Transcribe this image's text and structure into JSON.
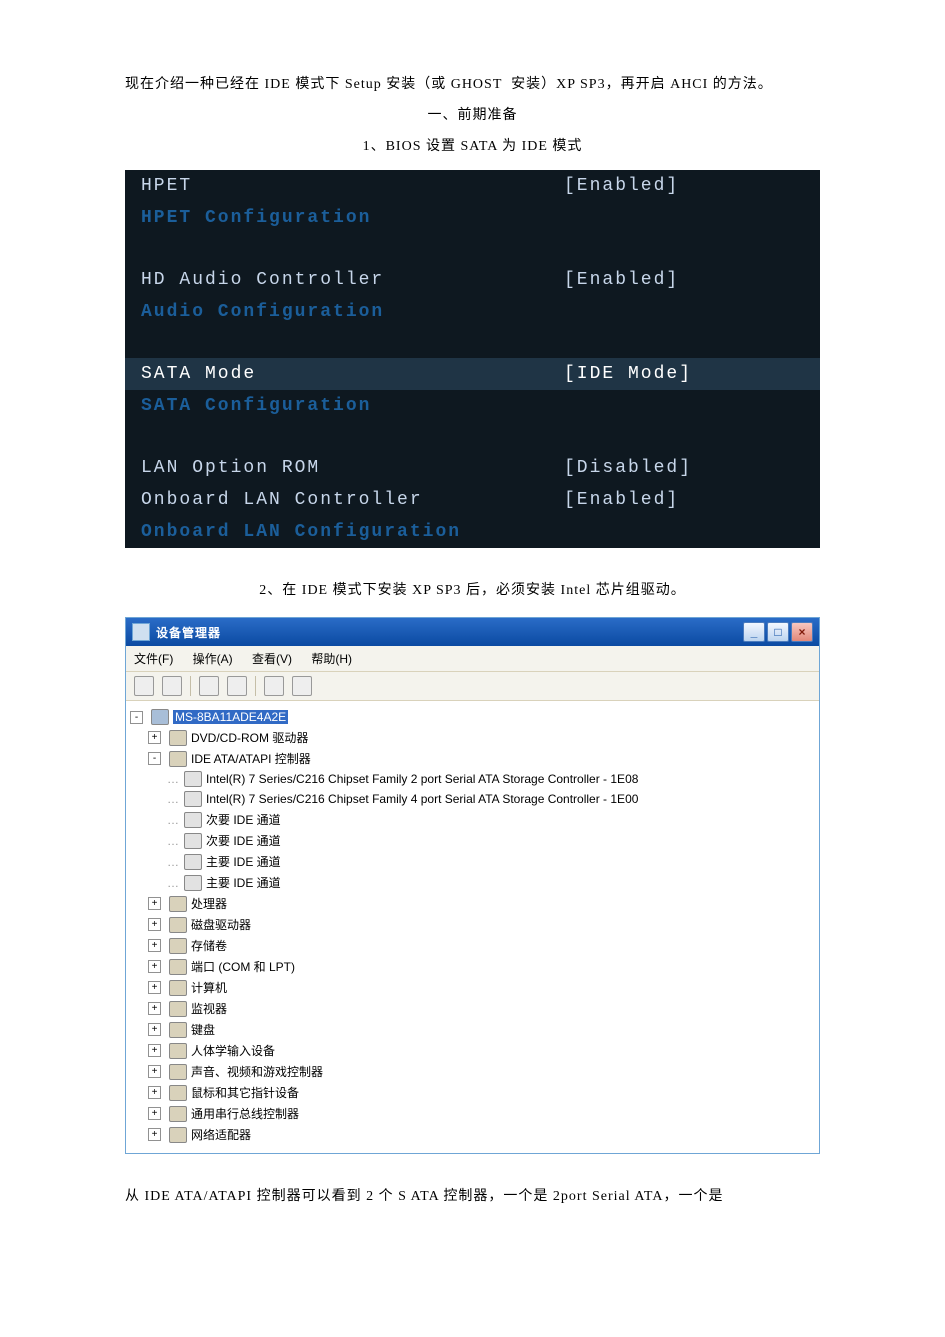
{
  "doc": {
    "p1": "现在介绍一种已经在 IDE 模式下 Setup 安装（或 GHOST  安装）XP SP3，再开启 AHCI 的方法。",
    "h1": "一、前期准备",
    "s1": "1、BIOS 设置 SATA 为 IDE 模式",
    "s2": "2、在 IDE 模式下安装 XP SP3 后，必须安装 Intel 芯片组驱动。",
    "p2": "从 IDE ATA/ATAPI 控制器可以看到 2 个 S ATA 控制器，一个是 2port Serial ATA，一个是"
  },
  "bios": {
    "rows": [
      {
        "type": "header",
        "label": "Onboard LAN Configuration",
        "value": ""
      },
      {
        "type": "item",
        "label": "Onboard LAN Controller",
        "value": "[Enabled]"
      },
      {
        "type": "item",
        "label": "LAN Option ROM",
        "value": "[Disabled]"
      },
      {
        "type": "gap"
      },
      {
        "type": "header",
        "label": "SATA Configuration",
        "value": ""
      },
      {
        "type": "selected",
        "label": "SATA Mode",
        "value": "[IDE Mode]"
      },
      {
        "type": "gap"
      },
      {
        "type": "header",
        "label": "Audio Configuration",
        "value": ""
      },
      {
        "type": "item",
        "label": "HD Audio Controller",
        "value": "[Enabled]"
      },
      {
        "type": "gap"
      },
      {
        "type": "header",
        "label": "HPET Configuration",
        "value": ""
      },
      {
        "type": "item",
        "label": "HPET",
        "value": "[Enabled]"
      }
    ]
  },
  "dm": {
    "title": "设备管理器",
    "menu": {
      "file": "文件(F)",
      "action": "操作(A)",
      "view": "查看(V)",
      "help": "帮助(H)"
    },
    "root": "MS-8BA11ADE4A2E",
    "tree": [
      {
        "expand": "-",
        "icon": "computer",
        "label": "MS-8BA11ADE4A2E",
        "selected": true,
        "depth": 0
      },
      {
        "expand": "+",
        "icon": "dev",
        "label": "DVD/CD-ROM 驱动器",
        "depth": 1
      },
      {
        "expand": "-",
        "icon": "dev",
        "label": "IDE ATA/ATAPI 控制器",
        "depth": 1
      },
      {
        "expand": "",
        "icon": "drive",
        "label": "Intel(R) 7 Series/C216 Chipset Family 2 port Serial ATA Storage Controller - 1E08",
        "depth": 2
      },
      {
        "expand": "",
        "icon": "drive",
        "label": "Intel(R) 7 Series/C216 Chipset Family 4 port Serial ATA Storage Controller - 1E00",
        "depth": 2
      },
      {
        "expand": "",
        "icon": "drive",
        "label": "次要 IDE 通道",
        "depth": 2
      },
      {
        "expand": "",
        "icon": "drive",
        "label": "次要 IDE 通道",
        "depth": 2
      },
      {
        "expand": "",
        "icon": "drive",
        "label": "主要 IDE 通道",
        "depth": 2
      },
      {
        "expand": "",
        "icon": "drive",
        "label": "主要 IDE 通道",
        "depth": 2
      },
      {
        "expand": "+",
        "icon": "dev",
        "label": "处理器",
        "depth": 1
      },
      {
        "expand": "+",
        "icon": "dev",
        "label": "磁盘驱动器",
        "depth": 1
      },
      {
        "expand": "+",
        "icon": "dev",
        "label": "存储卷",
        "depth": 1
      },
      {
        "expand": "+",
        "icon": "dev",
        "label": "端口 (COM 和 LPT)",
        "depth": 1
      },
      {
        "expand": "+",
        "icon": "dev",
        "label": "计算机",
        "depth": 1
      },
      {
        "expand": "+",
        "icon": "dev",
        "label": "监视器",
        "depth": 1
      },
      {
        "expand": "+",
        "icon": "dev",
        "label": "键盘",
        "depth": 1
      },
      {
        "expand": "+",
        "icon": "dev",
        "label": "人体学输入设备",
        "depth": 1
      },
      {
        "expand": "+",
        "icon": "dev",
        "label": "声音、视频和游戏控制器",
        "depth": 1
      },
      {
        "expand": "+",
        "icon": "dev",
        "label": "鼠标和其它指针设备",
        "depth": 1
      },
      {
        "expand": "+",
        "icon": "dev",
        "label": "通用串行总线控制器",
        "depth": 1
      },
      {
        "expand": "+",
        "icon": "dev",
        "label": "网络适配器",
        "depth": 1
      }
    ]
  }
}
